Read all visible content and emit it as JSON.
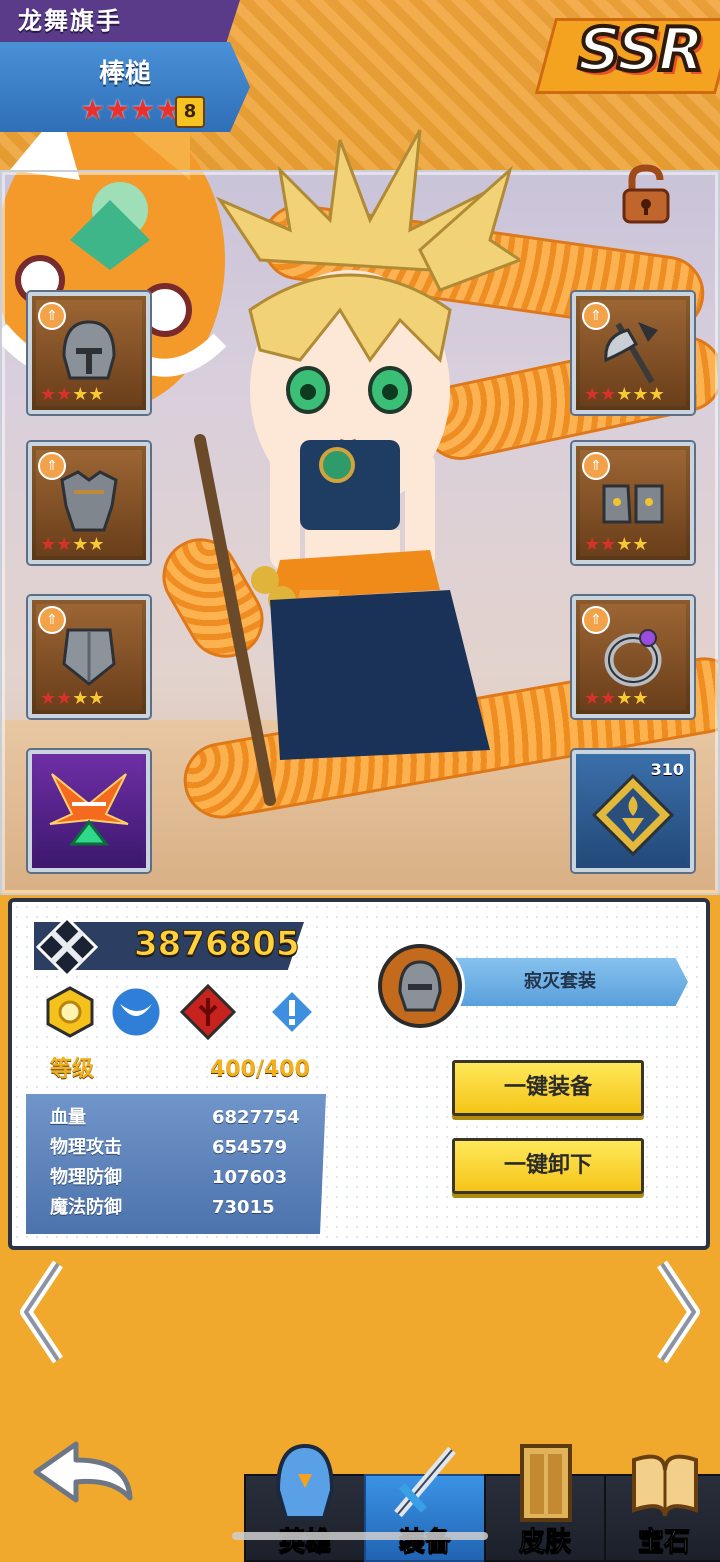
{
  "hero": {
    "title": "龙舞旗手",
    "name": "棒槌",
    "star_count": 5,
    "rank_badge": "8",
    "rarity": "SSR"
  },
  "equipment": {
    "slots": [
      {
        "id": "helmet",
        "icon": "helmet-icon",
        "red_stars": 2,
        "gold_stars": 2
      },
      {
        "id": "weapon",
        "icon": "axe-icon",
        "red_stars": 2,
        "gold_stars": 3
      },
      {
        "id": "armor",
        "icon": "chest-armor-icon",
        "red_stars": 2,
        "gold_stars": 2
      },
      {
        "id": "boots",
        "icon": "boots-icon",
        "red_stars": 2,
        "gold_stars": 2
      },
      {
        "id": "shield",
        "icon": "shield-icon",
        "red_stars": 2,
        "gold_stars": 2
      },
      {
        "id": "ring",
        "icon": "ring-icon",
        "red_stars": 2,
        "gold_stars": 2
      }
    ],
    "artifact_icon": "phoenix-artifact-icon",
    "rune_icon": "rune-emblem-icon",
    "rune_count": "310"
  },
  "stats": {
    "power": "3876805",
    "level_label": "等级",
    "level_value": "400/400",
    "rows": [
      {
        "label": "血量",
        "value": "6827754"
      },
      {
        "label": "物理攻击",
        "value": "654579"
      },
      {
        "label": "物理防御",
        "value": "107603"
      },
      {
        "label": "魔法防御",
        "value": "73015"
      }
    ]
  },
  "skills": [
    "sun-skill-icon",
    "slash-skill-icon",
    "red-rune-skill-icon",
    "info-icon"
  ],
  "set": {
    "name": "寂灭套装"
  },
  "actions": {
    "equip_all": "一键装备",
    "unequip_all": "一键卸下"
  },
  "tabs": [
    {
      "id": "hero",
      "label": "英雄",
      "icon": "helmet-tab-icon"
    },
    {
      "id": "equip",
      "label": "装备",
      "icon": "sword-tab-icon"
    },
    {
      "id": "skin",
      "label": "皮肤",
      "icon": "wardrobe-tab-icon"
    },
    {
      "id": "gem",
      "label": "宝石",
      "icon": "book-tab-icon"
    }
  ],
  "colors": {
    "background": "#f0a92c",
    "title_banner": "#5a3b8a",
    "name_banner": "#3a82cc",
    "power_text": "#ffd23e",
    "button_yellow": "#f5c518",
    "active_tab": "#3b93e6"
  }
}
